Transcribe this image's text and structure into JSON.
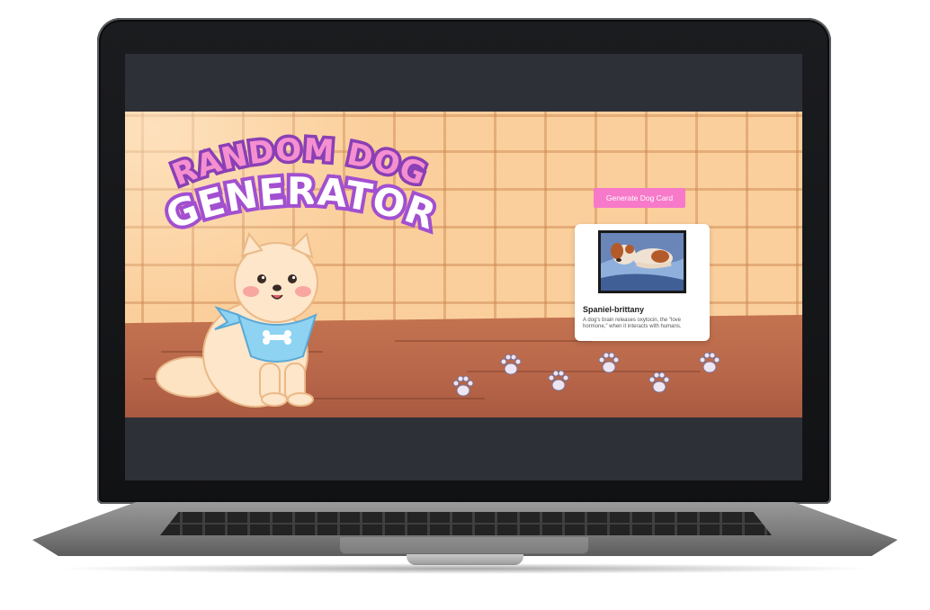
{
  "page": {
    "title_line1": "RANDOM DOG",
    "title_line2": "GENERATOR"
  },
  "controls": {
    "generate_label": "Generate Dog Card"
  },
  "dog_card": {
    "breed": "Spaniel-brittany",
    "fact": "A dog's brain releases oxytocin, the \"love hormone,\" when it interacts with humans."
  },
  "colors": {
    "accent_pink": "#f779c9",
    "title_fill": "#f58fd0",
    "title_outline": "#8a3fb5",
    "wall": "#fbcf9c",
    "floor": "#b8664a"
  },
  "icons": {
    "paw": "paw-print-icon",
    "bone": "bone-icon"
  }
}
